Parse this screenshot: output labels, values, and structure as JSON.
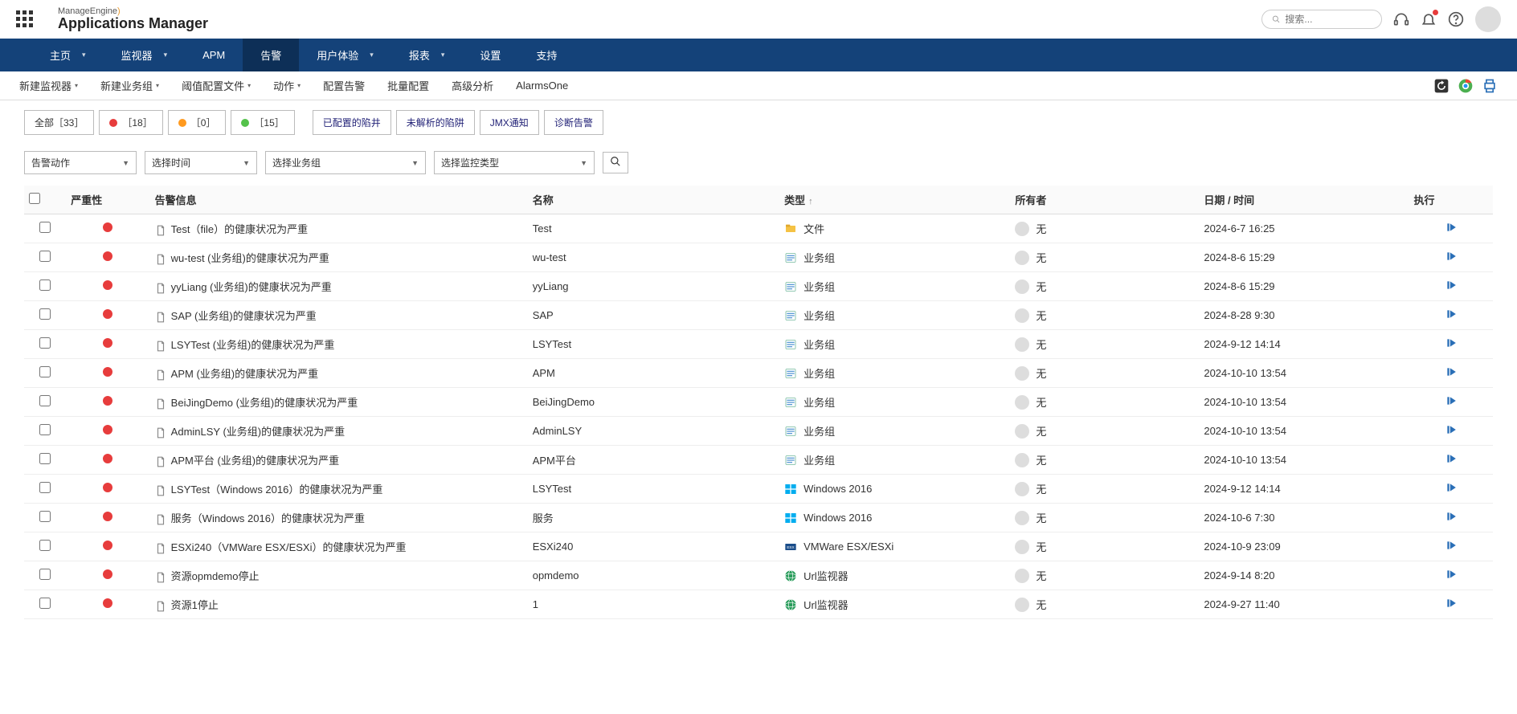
{
  "brand": {
    "small": "ManageEngine",
    "big": "Applications Manager"
  },
  "search": {
    "placeholder": "搜索..."
  },
  "mainNav": [
    {
      "label": "主页",
      "caret": true
    },
    {
      "label": "监视器",
      "caret": true
    },
    {
      "label": "APM",
      "caret": false
    },
    {
      "label": "告警",
      "caret": false,
      "active": true
    },
    {
      "label": "用户体验",
      "caret": true
    },
    {
      "label": "报表",
      "caret": true
    },
    {
      "label": "设置",
      "caret": false
    },
    {
      "label": "支持",
      "caret": false
    }
  ],
  "subNav": [
    {
      "label": "新建监视器",
      "caret": true
    },
    {
      "label": "新建业务组",
      "caret": true
    },
    {
      "label": "阈值配置文件",
      "caret": true
    },
    {
      "label": "动作",
      "caret": true
    },
    {
      "label": "配置告警",
      "caret": false
    },
    {
      "label": "批量配置",
      "caret": false
    },
    {
      "label": "高级分析",
      "caret": false
    },
    {
      "label": "AlarmsOne",
      "caret": false
    }
  ],
  "tabs": {
    "all": "全部［33］",
    "red": "［18］",
    "orange": "［0］",
    "green": "［15］",
    "links": [
      "已配置的陷井",
      "未解析的陷阱",
      "JMX通知",
      "诊断告警"
    ]
  },
  "filters": {
    "f1": "告警动作",
    "f2": "选择时间",
    "f3": "选择业务组",
    "f4": "选择监控类型"
  },
  "columns": {
    "sev": "严重性",
    "msg": "告警信息",
    "name": "名称",
    "type": "类型",
    "owner": "所有者",
    "date": "日期 / 时间",
    "exec": "执行"
  },
  "rows": [
    {
      "msg": "Test（file）的健康状况为严重",
      "name": "Test",
      "typeIcon": "file",
      "type": "文件",
      "owner": "无",
      "date": "2024-6-7 16:25"
    },
    {
      "msg": "wu-test (业务组)的健康状况为严重",
      "name": "wu-test",
      "typeIcon": "group",
      "type": "业务组",
      "owner": "无",
      "date": "2024-8-6 15:29"
    },
    {
      "msg": "yyLiang (业务组)的健康状况为严重",
      "name": "yyLiang",
      "typeIcon": "group",
      "type": "业务组",
      "owner": "无",
      "date": "2024-8-6 15:29"
    },
    {
      "msg": "SAP (业务组)的健康状况为严重",
      "name": "SAP",
      "typeIcon": "group",
      "type": "业务组",
      "owner": "无",
      "date": "2024-8-28 9:30"
    },
    {
      "msg": "LSYTest (业务组)的健康状况为严重",
      "name": "LSYTest",
      "typeIcon": "group",
      "type": "业务组",
      "owner": "无",
      "date": "2024-9-12 14:14"
    },
    {
      "msg": "APM (业务组)的健康状况为严重",
      "name": "APM",
      "typeIcon": "group",
      "type": "业务组",
      "owner": "无",
      "date": "2024-10-10 13:54"
    },
    {
      "msg": "BeiJingDemo (业务组)的健康状况为严重",
      "name": "BeiJingDemo",
      "typeIcon": "group",
      "type": "业务组",
      "owner": "无",
      "date": "2024-10-10 13:54"
    },
    {
      "msg": "AdminLSY (业务组)的健康状况为严重",
      "name": "AdminLSY",
      "typeIcon": "group",
      "type": "业务组",
      "owner": "无",
      "date": "2024-10-10 13:54"
    },
    {
      "msg": "APM平台 (业务组)的健康状况为严重",
      "name": "APM平台",
      "typeIcon": "group",
      "type": "业务组",
      "owner": "无",
      "date": "2024-10-10 13:54"
    },
    {
      "msg": "LSYTest（Windows 2016）的健康状况为严重",
      "name": "LSYTest",
      "typeIcon": "win",
      "type": "Windows 2016",
      "owner": "无",
      "date": "2024-9-12 14:14"
    },
    {
      "msg": "服务（Windows 2016）的健康状况为严重",
      "name": "服务",
      "typeIcon": "win",
      "type": "Windows 2016",
      "owner": "无",
      "date": "2024-10-6 7:30"
    },
    {
      "msg": "ESXi240（VMWare ESX/ESXi）的健康状况为严重",
      "name": "ESXi240",
      "typeIcon": "esx",
      "type": "VMWare ESX/ESXi",
      "owner": "无",
      "date": "2024-10-9 23:09"
    },
    {
      "msg": "资源opmdemo停止",
      "name": "opmdemo",
      "typeIcon": "url",
      "type": "Url监视器",
      "owner": "无",
      "date": "2024-9-14 8:20"
    },
    {
      "msg": "资源1停止",
      "name": "1",
      "typeIcon": "url",
      "type": "Url监视器",
      "owner": "无",
      "date": "2024-9-27 11:40"
    }
  ]
}
